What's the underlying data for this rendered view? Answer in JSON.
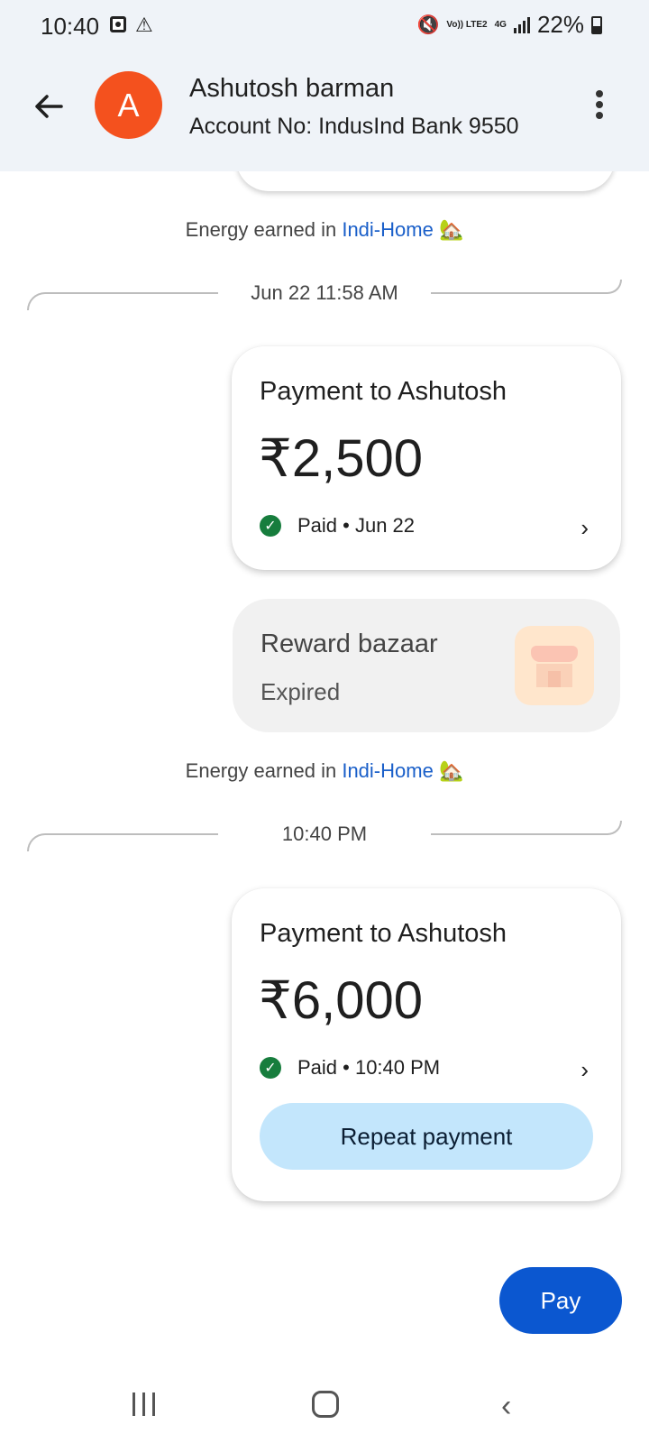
{
  "status_bar": {
    "time": "10:40",
    "volte": "Vo)) LTE2",
    "network": "4G",
    "battery": "22%"
  },
  "header": {
    "avatar_letter": "A",
    "name": "Ashutosh barman",
    "account": "Account No: IndusInd Bank 9550"
  },
  "energy_notice": {
    "prefix": "Energy earned in ",
    "link": "Indi-Home",
    "emoji": "🏡"
  },
  "messages": [
    {
      "date_label": "Jun 22 11:58 AM",
      "title": "Payment to Ashutosh",
      "amount": "₹2,500",
      "status": "Paid • Jun 22"
    },
    {
      "date_label": "10:40 PM",
      "title": "Payment to Ashutosh",
      "amount": "₹6,000",
      "status": "Paid • 10:40 PM",
      "action": "Repeat payment"
    }
  ],
  "reward": {
    "title": "Reward bazaar",
    "subtitle": "Expired"
  },
  "pay_button": "Pay",
  "colors": {
    "header_bg": "#eff3f8",
    "avatar": "#f4511e",
    "link": "#1a5fc9",
    "paid_check": "#177d3d",
    "repeat_bg": "#c3e6fc",
    "pay_fab": "#0b57d0"
  },
  "icons": {
    "back": "arrow-left-icon",
    "more": "more-vert-icon",
    "check": "check-circle-icon",
    "chevron": "chevron-right-icon",
    "shop": "storefront-icon"
  }
}
